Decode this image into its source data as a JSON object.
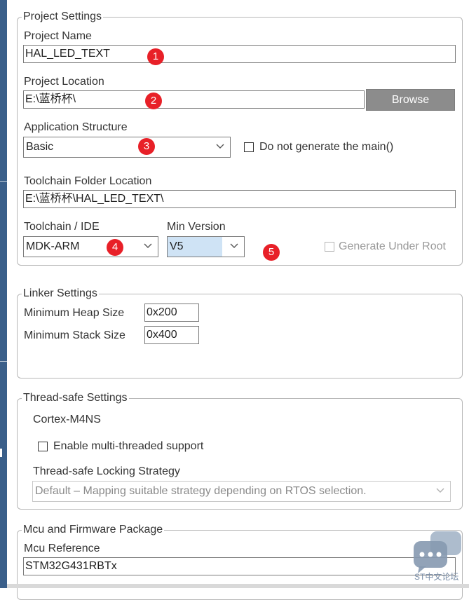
{
  "project_settings": {
    "legend": "Project Settings",
    "project_name_label": "Project Name",
    "project_name_value": "HAL_LED_TEXT",
    "project_location_label": "Project Location",
    "project_location_value": "E:\\蓝桥杯\\",
    "browse_label": "Browse",
    "app_structure_label": "Application Structure",
    "app_structure_value": "Basic",
    "do_not_generate_main_label": "Do not generate the main()",
    "toolchain_folder_label": "Toolchain Folder Location",
    "toolchain_folder_value": "E:\\蓝桥杯\\HAL_LED_TEXT\\",
    "toolchain_ide_label": "Toolchain / IDE",
    "toolchain_ide_value": "MDK-ARM",
    "min_version_label": "Min Version",
    "min_version_value": "V5",
    "generate_under_root_label": "Generate Under Root"
  },
  "annotations": [
    "1",
    "2",
    "3",
    "4",
    "5"
  ],
  "linker_settings": {
    "legend": "Linker Settings",
    "min_heap_label": "Minimum Heap Size",
    "min_heap_value": "0x200",
    "min_stack_label": "Minimum Stack Size",
    "min_stack_value": "0x400"
  },
  "thread_safe_settings": {
    "legend": "Thread-safe Settings",
    "core": "Cortex-M4NS",
    "enable_multithread_label": "Enable multi-threaded support",
    "locking_strategy_label": "Thread-safe Locking Strategy",
    "locking_strategy_value": "Default  –  Mapping suitable strategy depending on RTOS selection."
  },
  "mcu_firmware": {
    "legend": "Mcu and Firmware Package",
    "mcu_reference_label": "Mcu Reference",
    "mcu_reference_value": "STM32G431RBTx"
  },
  "watermark": {
    "text": "ST中文论坛"
  },
  "colors": {
    "badge": "#e82028",
    "browse_bg": "#8c8c8c",
    "min_version_selected": "#cfe3f5",
    "left_strip": "#3a5f8a"
  }
}
